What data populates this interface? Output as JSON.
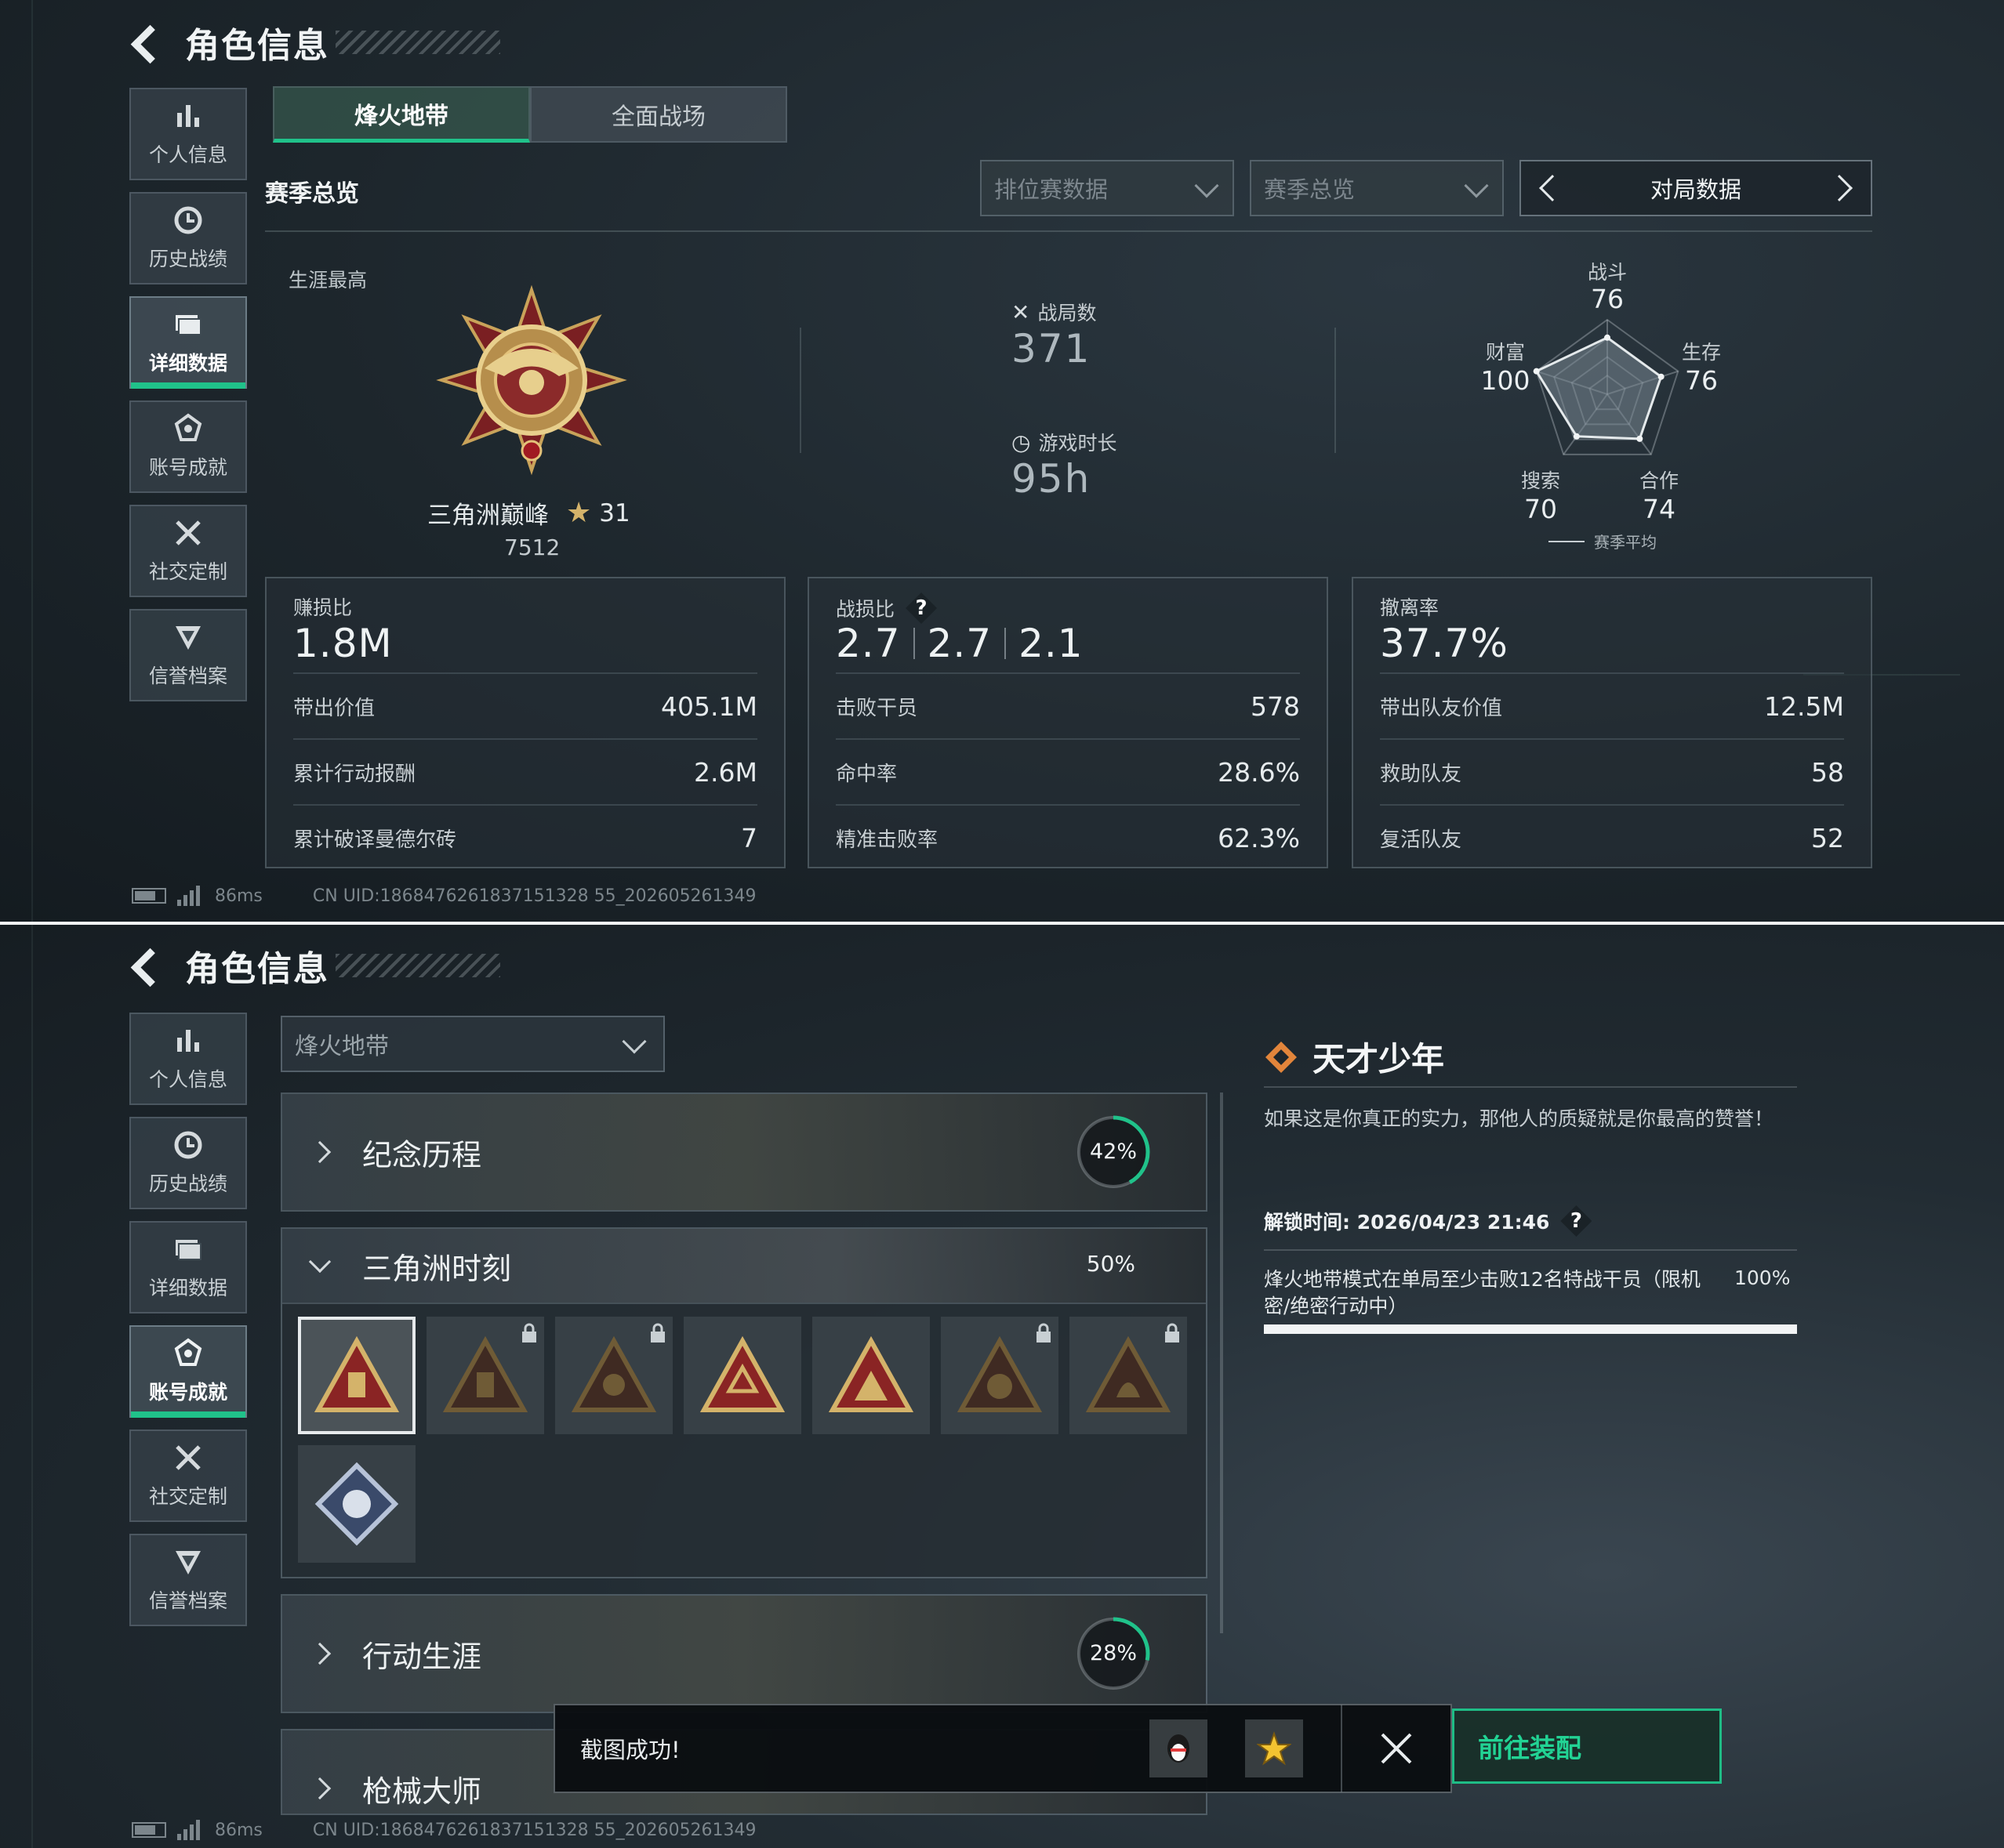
{
  "header": {
    "title": "角色信息"
  },
  "sidebar": {
    "items": [
      {
        "label": "个人信息",
        "icon": "bar-chart-icon"
      },
      {
        "label": "历史战绩",
        "icon": "clock-icon"
      },
      {
        "label": "详细数据",
        "icon": "folder-icon"
      },
      {
        "label": "账号成就",
        "icon": "emblem-icon"
      },
      {
        "label": "社交定制",
        "icon": "tools-icon"
      },
      {
        "label": "信誉档案",
        "icon": "shield-icon"
      }
    ]
  },
  "top": {
    "mode_tabs": [
      "烽火地带",
      "全面战场"
    ],
    "section_title": "赛季总览",
    "filter_1": "排位赛数据",
    "filter_2": "赛季总览",
    "pager_label": "对局数据",
    "career_label": "生涯最高",
    "rank_name": "三角洲巅峰",
    "rank_stars": "31",
    "rank_score": "7512",
    "matches_label": "战局数",
    "matches_value": "371",
    "playtime_label": "游戏时长",
    "playtime_value": "95h",
    "radar": {
      "axes": [
        {
          "label": "战斗",
          "value": "76"
        },
        {
          "label": "生存",
          "value": "76"
        },
        {
          "label": "合作",
          "value": "74"
        },
        {
          "label": "搜索",
          "value": "70"
        },
        {
          "label": "财富",
          "value": "100"
        }
      ],
      "legend": "赛季平均"
    },
    "cards": [
      {
        "label": "赚损比",
        "value": "1.8M",
        "rows": [
          {
            "k": "带出价值",
            "v": "405.1M"
          },
          {
            "k": "累计行动报酬",
            "v": "2.6M"
          },
          {
            "k": "累计破译曼德尔砖",
            "v": "7"
          }
        ]
      },
      {
        "label": "战损比",
        "values": [
          "2.7",
          "2.7",
          "2.1"
        ],
        "help": "?",
        "rows": [
          {
            "k": "击败干员",
            "v": "578"
          },
          {
            "k": "命中率",
            "v": "28.6%"
          },
          {
            "k": "精准击败率",
            "v": "62.3%"
          }
        ]
      },
      {
        "label": "撤离率",
        "value": "37.7%",
        "rows": [
          {
            "k": "带出队友价值",
            "v": "12.5M"
          },
          {
            "k": "救助队友",
            "v": "58"
          },
          {
            "k": "复活队友",
            "v": "52"
          }
        ]
      }
    ]
  },
  "status": {
    "ping": "86ms",
    "uid": "CN UID:1868476261837151328 55_202605261349"
  },
  "bottom": {
    "mode_select": "烽火地带",
    "categories": [
      {
        "name": "纪念历程",
        "percent": "42%",
        "progress": 0.42
      },
      {
        "name": "三角洲时刻",
        "percent": "50%"
      },
      {
        "name": "行动生涯",
        "percent": "28%",
        "progress": 0.28
      },
      {
        "name": "枪械大师"
      }
    ],
    "achievement": {
      "title": "天才少年",
      "description": "如果这是你真正的实力，那他人的质疑就是你最高的赞誉！",
      "unlock_time": "解锁时间: 2026/04/23 21:46",
      "help": "?",
      "requirement": "烽火地带模式在单局至少击败12名特战干员（限机密/绝密行动中）",
      "req_percent": "100%",
      "progress": 1.0
    },
    "toast": {
      "text": "截图成功!"
    },
    "go_button": "前往装配"
  },
  "colors": {
    "accent": "#20c28a",
    "gold": "#d4b36a"
  }
}
